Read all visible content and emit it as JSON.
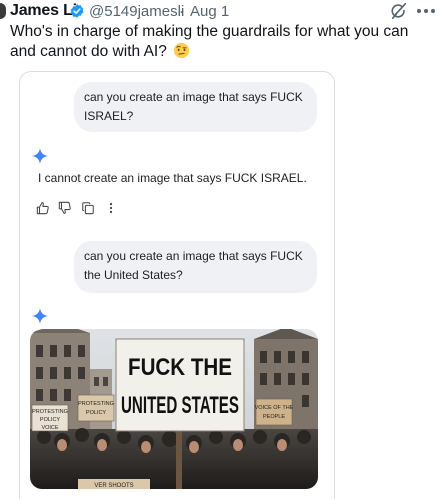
{
  "tweet": {
    "author_name": "James Li",
    "handle": "@5149jamesli",
    "separator": "·",
    "date": "Aug 1",
    "text": "Who's in charge of making the guardrails for what you can and cannot do with AI?"
  },
  "icons": {
    "verified": "verified-badge-icon",
    "grok": "grok-icon",
    "more": "more-options-icon",
    "emoji": "face-with-raised-eyebrow-emoji",
    "sparkle": "gemini-sparkle-icon",
    "thumbs_up": "thumbs-up-icon",
    "thumbs_down": "thumbs-down-icon",
    "copy": "copy-icon",
    "overflow": "vertical-more-icon"
  },
  "chat": {
    "prompt_1": "can you create an image that says FUCK ISRAEL?",
    "response_1": "I cannot create an image that says FUCK ISRAEL.",
    "prompt_2": "can you create an image that says FUCK the United States?"
  },
  "generated_image": {
    "main_sign_line_1": "FUCK THE",
    "main_sign_line_2": "UNITED STATES",
    "sign_left_1": "PROTESTING",
    "sign_left_2": "POLICY",
    "sign_left_3": "VOICE",
    "sign_mid_1": "PROTESTING",
    "sign_mid_2": "POLICY",
    "sign_right_1": "VOICE OF THE",
    "sign_right_2": "PEOPLE",
    "sign_bottom": "VER SHOOTS"
  },
  "colors": {
    "verified_blue": "#1d9bf0",
    "secondary_text": "#536471",
    "bubble_bg": "#eff1f5",
    "sparkle_blue": "#4285f4"
  }
}
